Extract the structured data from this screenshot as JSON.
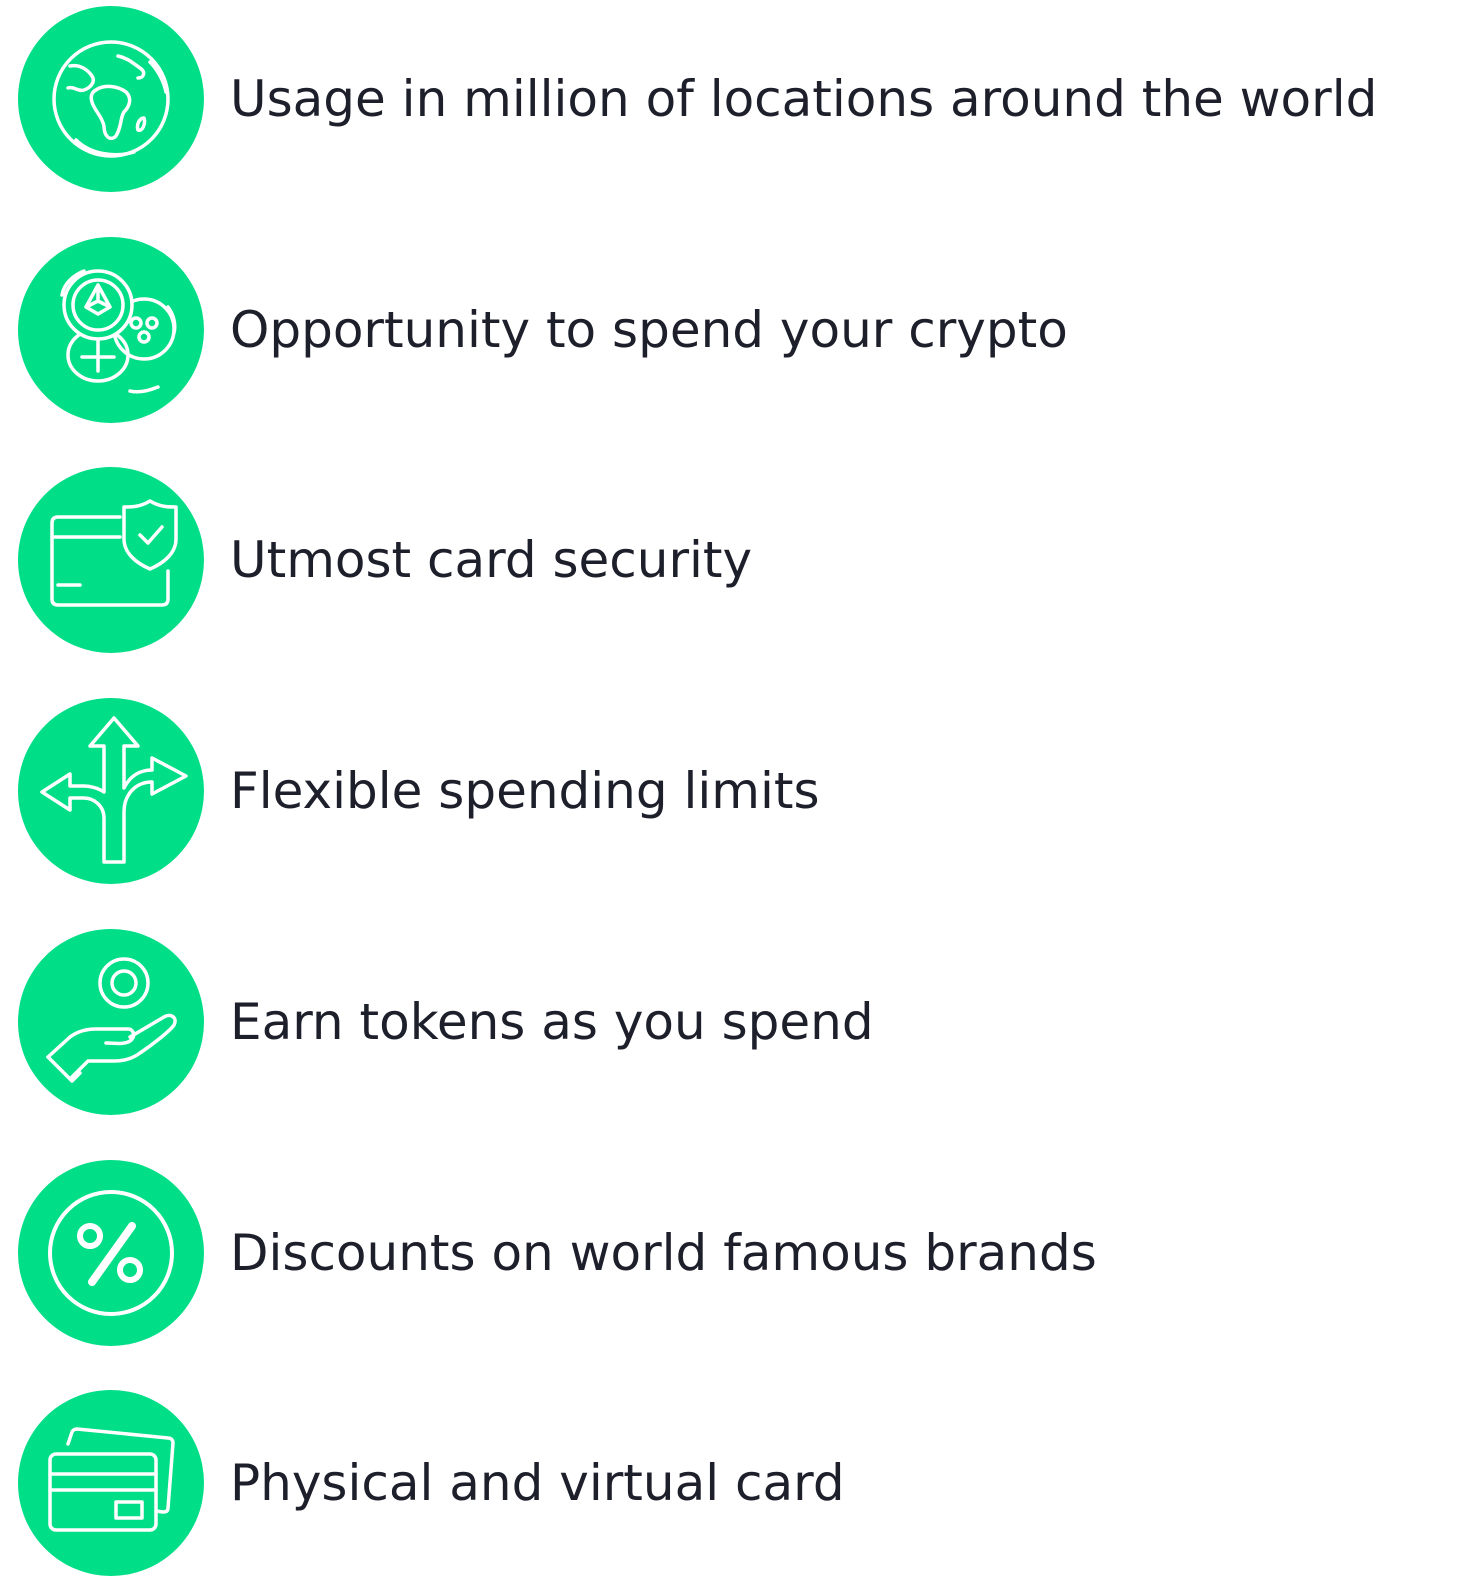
{
  "accent_color": "#00de87",
  "features": [
    {
      "icon": "globe-icon",
      "label": "Usage in million of locations around the world"
    },
    {
      "icon": "crypto-coins-icon",
      "label": "Opportunity to spend your crypto"
    },
    {
      "icon": "card-shield-icon",
      "label": "Utmost card security"
    },
    {
      "icon": "split-arrows-icon",
      "label": "Flexible spending limits"
    },
    {
      "icon": "hand-coin-icon",
      "label": "Earn tokens as you spend"
    },
    {
      "icon": "percent-icon",
      "label": "Discounts on world famous brands"
    },
    {
      "icon": "cards-icon",
      "label": "Physical and virtual card"
    }
  ]
}
